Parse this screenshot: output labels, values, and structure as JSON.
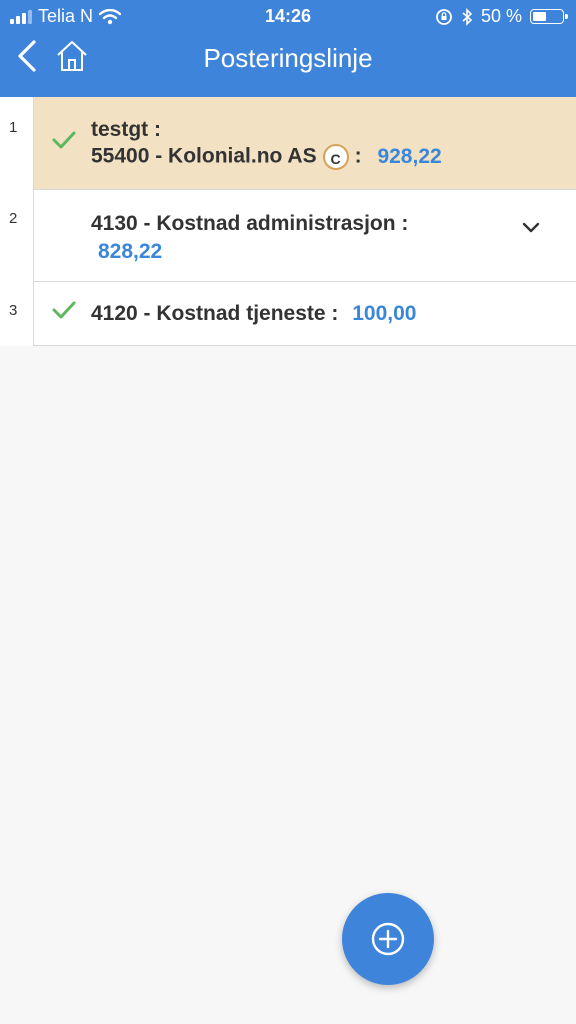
{
  "status_bar": {
    "carrier": "Telia N",
    "time": "14:26",
    "battery_percent": "50 %",
    "battery_level": 0.5
  },
  "header": {
    "title": "Posteringslinje",
    "back_icon": "chevron-left-icon",
    "home_icon": "home-icon",
    "background_color": "#3f84db"
  },
  "rows": [
    {
      "number": "1",
      "checked": true,
      "selected": true,
      "line1": "testgt :",
      "line2": "55400 - Kolonial.no AS",
      "badge": "C",
      "separator": ":",
      "amount": "928,22"
    },
    {
      "number": "2",
      "checked": false,
      "selected": false,
      "line1": "4130 - Kostnad administrasjon :",
      "amount": "828,22",
      "expand_icon": "chevron-down-icon"
    },
    {
      "number": "3",
      "checked": true,
      "selected": false,
      "line1": "4120 - Kostnad tjeneste :",
      "amount": "100,00"
    }
  ],
  "colors": {
    "accent": "#3f84db",
    "amount": "#3a86d9",
    "check": "#5cb85c",
    "selected_row": "#f2e1c3"
  },
  "fab": {
    "icon": "plus-circle-icon"
  }
}
